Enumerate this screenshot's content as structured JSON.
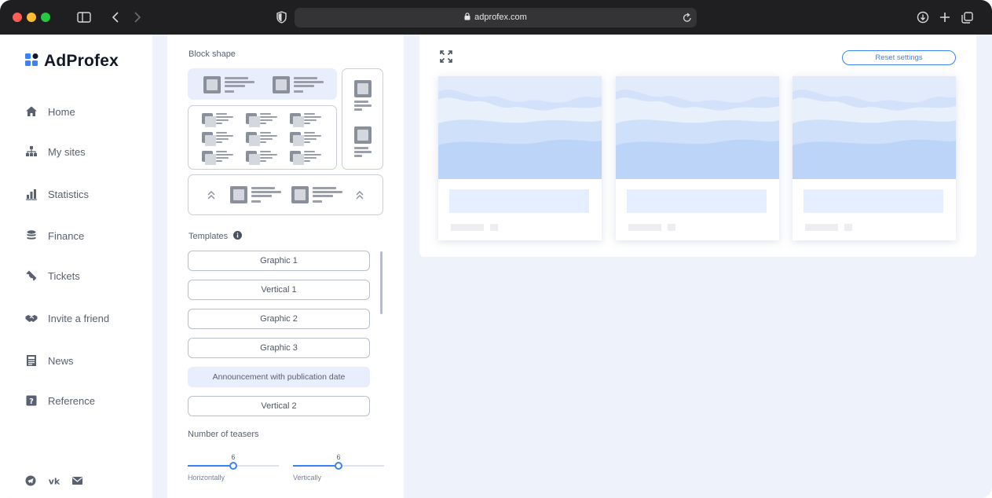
{
  "browser": {
    "url": "adprofex.com",
    "traffic_lights": [
      "#ff5f57",
      "#febc2e",
      "#28c840"
    ]
  },
  "brand": {
    "name": "AdProfex",
    "logo_colors": [
      "#3b82f6",
      "#111827"
    ]
  },
  "nav": {
    "items": [
      {
        "label": "Home",
        "icon": "home-icon"
      },
      {
        "label": "My sites",
        "icon": "sitemap-icon"
      },
      {
        "label": "Statistics",
        "icon": "bar-chart-icon"
      },
      {
        "label": "Finance",
        "icon": "coins-icon"
      },
      {
        "label": "Tickets",
        "icon": "ticket-icon"
      },
      {
        "label": "Invite a friend",
        "icon": "handshake-icon"
      },
      {
        "label": "News",
        "icon": "newspaper-icon"
      },
      {
        "label": "Reference",
        "icon": "question-icon"
      }
    ],
    "social": [
      "telegram-icon",
      "vk-icon",
      "mail-icon"
    ]
  },
  "panel": {
    "block_shape_title": "Block shape",
    "templates_title": "Templates",
    "templates": [
      {
        "label": "Graphic 1",
        "active": false
      },
      {
        "label": "Vertical 1",
        "active": false
      },
      {
        "label": "Graphic 2",
        "active": false
      },
      {
        "label": "Graphic 3",
        "active": false
      },
      {
        "label": "Announcement with publication date",
        "active": true
      },
      {
        "label": "Vertical 2",
        "active": false
      }
    ],
    "teasers_title": "Number of teasers",
    "horizontal": {
      "value": "6",
      "label": "Horizontally",
      "fraction": 0.5
    },
    "vertical": {
      "value": "6",
      "label": "Vertically",
      "fraction": 0.5
    }
  },
  "preview": {
    "reset_label": "Reset settings",
    "accent": "#3b82f6"
  }
}
